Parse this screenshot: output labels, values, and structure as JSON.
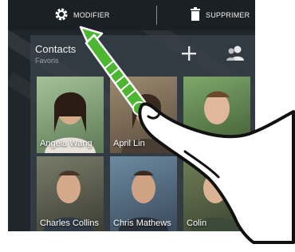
{
  "topbar": {
    "modify_label": "MODIFIER",
    "delete_label": "SUPPRIMER"
  },
  "widget": {
    "title": "Contacts",
    "subtitle": "Favoris"
  },
  "contacts": [
    {
      "name": "Angela Wang"
    },
    {
      "name": "April Lin"
    },
    {
      "name": "Ben Carter"
    },
    {
      "name": "Charles Collins"
    },
    {
      "name": "Chris Mathews"
    },
    {
      "name": "Colin"
    }
  ],
  "colors": {
    "accent_green": "#4cb531",
    "bar_dark": "#1b2024"
  },
  "icons": {
    "modify": "gear-icon",
    "delete": "trash-icon",
    "add": "plus-icon",
    "people": "people-icon"
  }
}
